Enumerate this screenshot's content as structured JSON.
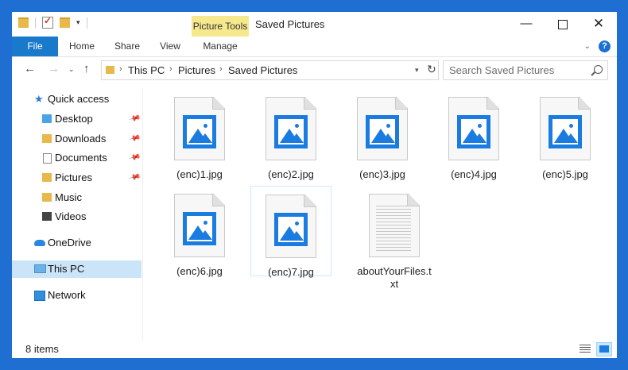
{
  "window": {
    "title": "Saved Pictures",
    "context_tab_group": "Picture Tools",
    "controls": {
      "minimize": "—",
      "maximize": "",
      "close": "✕"
    }
  },
  "ribbon": {
    "tabs": [
      "File",
      "Home",
      "Share",
      "View",
      "Manage"
    ],
    "expand_glyph": "⌄",
    "help_glyph": "?"
  },
  "address": {
    "breadcrumbs": [
      "This PC",
      "Pictures",
      "Saved Pictures"
    ],
    "separator": "›",
    "search_placeholder": "Search Saved Pictures"
  },
  "nav_glyphs": {
    "back": "←",
    "forward": "→",
    "recent": "⌄",
    "up": "↑",
    "refresh": "↻",
    "pin": "📌"
  },
  "sidebar": {
    "quick_access": "Quick access",
    "quick_items": [
      {
        "label": "Desktop",
        "pinned": true
      },
      {
        "label": "Downloads",
        "pinned": true
      },
      {
        "label": "Documents",
        "pinned": true
      },
      {
        "label": "Pictures",
        "pinned": true
      },
      {
        "label": "Music",
        "pinned": false
      },
      {
        "label": "Videos",
        "pinned": false
      }
    ],
    "onedrive": "OneDrive",
    "this_pc": "This PC",
    "network": "Network"
  },
  "files": [
    {
      "name": "(enc)1.jpg",
      "type": "image"
    },
    {
      "name": "(enc)2.jpg",
      "type": "image"
    },
    {
      "name": "(enc)3.jpg",
      "type": "image"
    },
    {
      "name": "(enc)4.jpg",
      "type": "image"
    },
    {
      "name": "(enc)5.jpg",
      "type": "image"
    },
    {
      "name": "(enc)6.jpg",
      "type": "image"
    },
    {
      "name": "(enc)7.jpg",
      "type": "image"
    },
    {
      "name": "aboutYourFiles.txt",
      "type": "text"
    }
  ],
  "status": {
    "item_count": "8 items"
  },
  "colors": {
    "frame": "#1e6fd1",
    "accent": "#1979ca",
    "context_tab": "#f6e98d",
    "selection": "#cce4f7",
    "image_icon": "#1a7be0"
  }
}
